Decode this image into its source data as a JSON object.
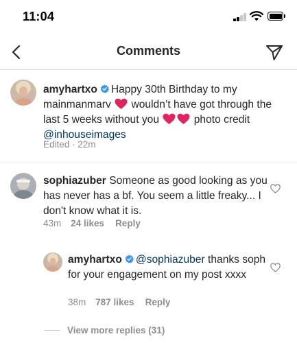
{
  "status_bar": {
    "time": "11:04"
  },
  "header": {
    "title": "Comments",
    "back_icon": "chevron-left-icon",
    "share_icon": "direct-send-icon"
  },
  "caption": {
    "username": "amyhartxo",
    "verified": true,
    "text_part1": "Happy 30th Birthday to my mainmanmarv",
    "text_part2": "wouldn’t have got through the last 5 weeks without you",
    "text_part3": "photo credit",
    "mention": "@inhouseimages",
    "meta": "Edited · 22m"
  },
  "comments": [
    {
      "username": "sophiazuber",
      "text": "Someone as good looking as you has never has a bf. You seem a little freaky... I don't know what it is.",
      "time": "43m",
      "likes": "24 likes",
      "reply_label": "Reply"
    }
  ],
  "reply": {
    "username": "amyhartxo",
    "verified": true,
    "mention": "@sophiazuber",
    "text": "thanks soph for your engagement on my post xxxx",
    "time": "38m",
    "likes": "787 likes",
    "reply_label": "Reply"
  },
  "view_more": "View more replies (31)",
  "colors": {
    "text": "#262626",
    "secondary": "#8e8e8e",
    "mention": "#003569",
    "verified": "#3897f0",
    "heart": "#e0245e",
    "divider": "#efefef"
  }
}
